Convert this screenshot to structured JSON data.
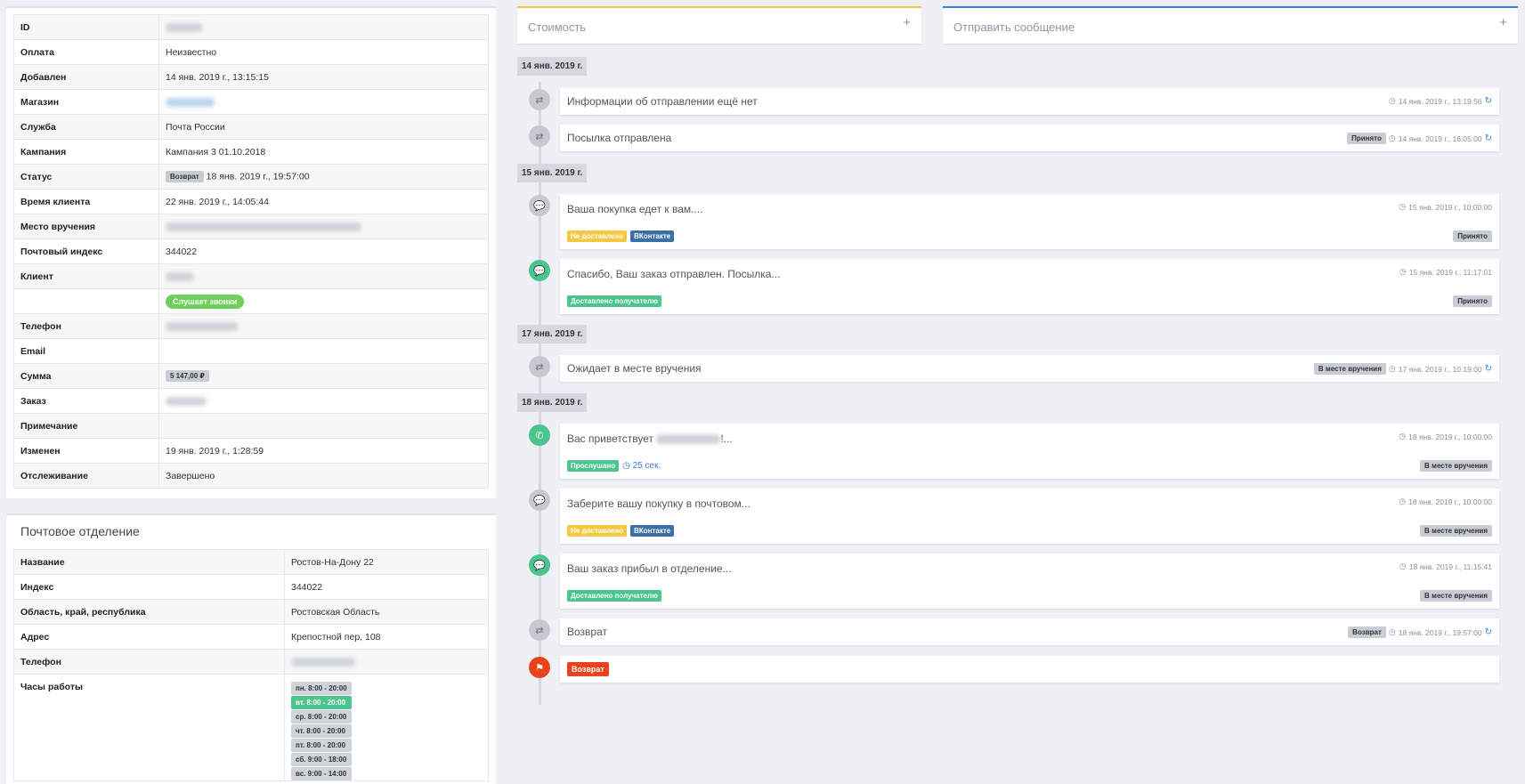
{
  "order": {
    "rows": [
      {
        "key": "ID",
        "value": ""
      },
      {
        "key": "Оплата",
        "value": "Неизвестно"
      },
      {
        "key": "Добавлен",
        "value": "14 янв. 2019 г., 13:15:15"
      },
      {
        "key": "Магазин",
        "value": ""
      },
      {
        "key": "Служба",
        "value": "Почта России"
      },
      {
        "key": "Кампания",
        "value": "Кампания 3 01.10.2018"
      },
      {
        "key": "Статус",
        "badge": "Возврат",
        "value": "18 янв. 2019 г., 19:57:00"
      },
      {
        "key": "Время клиента",
        "value": "22 янв. 2019 г., 14:05:44"
      },
      {
        "key": "Место вручения",
        "value": ""
      },
      {
        "key": "Почтовый индекс",
        "value": "344022"
      },
      {
        "key": "Клиент",
        "value": ""
      },
      {
        "key": "",
        "pill": "Слушает звонки"
      },
      {
        "key": "Телефон",
        "value": ""
      },
      {
        "key": "Email",
        "value": ""
      },
      {
        "key": "Сумма",
        "badge": "5 147,00 ₽"
      },
      {
        "key": "Заказ",
        "value": ""
      },
      {
        "key": "Примечание",
        "value": ""
      },
      {
        "key": "Изменен",
        "value": "19 янв. 2019 г., 1:28:59"
      },
      {
        "key": "Отслеживание",
        "value": "Завершено"
      }
    ]
  },
  "office": {
    "title": "Почтовое отделение",
    "rows": [
      {
        "key": "Название",
        "value": "Ростов-На-Дону 22"
      },
      {
        "key": "Индекс",
        "value": "344022"
      },
      {
        "key": "Область, край, республика",
        "value": "Ростовская Область"
      },
      {
        "key": "Адрес",
        "value": "Крепостной пер, 108"
      },
      {
        "key": "Телефон",
        "value": ""
      }
    ],
    "hours_label": "Часы работы",
    "hours": [
      "пн. 8:00 - 20:00",
      "вт. 8:00 - 20:00",
      "ср. 8:00 - 20:00",
      "чт. 8:00 - 20:00",
      "пт. 8:00 - 20:00",
      "сб. 9:00 - 18:00",
      "вс. 9:00 - 14:00"
    ],
    "hours_active_index": 1
  },
  "panels": {
    "cost": "Стоимость",
    "message": "Отправить сообщение",
    "plus": "+"
  },
  "timeline": {
    "dates": [
      "14 янв. 2019 г.",
      "15 янв. 2019 г.",
      "17 янв. 2019 г.",
      "18 янв. 2019 г."
    ],
    "events": [
      {
        "title": "Информации об отправлении ещё нет",
        "time": "14 янв. 2019 г., 13:19:56",
        "icon": "transfer-icon"
      },
      {
        "title": "Посылка отправлена",
        "badge": "Принято",
        "time": "14 янв. 2019 г., 16:05:00",
        "icon": "transfer-icon"
      },
      {
        "title": "Ваша покупка едет к вам....",
        "time": "15 янв. 2019 г., 10:00:00",
        "tags": [
          "Не доставлено",
          "ВКонтакте"
        ],
        "status": "Принято",
        "icon": "chat-icon"
      },
      {
        "title": "Спасибо, Ваш заказ отправлен. Посылка...",
        "time": "15 янв. 2019 г., 11:17:01",
        "tags": [
          "Доставлено получателю"
        ],
        "status": "Принято",
        "icon": "chat-icon"
      },
      {
        "title": "Ожидает в месте вручения",
        "badge": "В месте вручения",
        "time": "17 янв. 2019 г., 10:19:00",
        "icon": "transfer-icon"
      },
      {
        "title_prefix": "Вас приветствует",
        "title_suffix": "!...",
        "time": "18 янв. 2019 г., 10:00:00",
        "tags": [
          "Прослушано"
        ],
        "duration": "25 сек.",
        "status": "В месте вручения",
        "icon": "phone-icon"
      },
      {
        "title": "Заберите вашу покупку в почтовом...",
        "time": "18 янв. 2019 г., 10:00:00",
        "tags": [
          "Не доставлено",
          "ВКонтакте"
        ],
        "status": "В месте вручения",
        "icon": "chat-icon"
      },
      {
        "title": "Ваш заказ прибыл в отделение...",
        "time": "18 янв. 2019 г., 11:15:41",
        "tags": [
          "Доставлено получателю"
        ],
        "status": "В месте вручения",
        "icon": "chat-icon"
      },
      {
        "title": "Возврат",
        "badge": "Возврат",
        "time": "18 янв. 2019 г., 19:57:00",
        "icon": "transfer-icon"
      },
      {
        "final_tag": "Возврат",
        "icon": "flag-icon"
      }
    ]
  },
  "colors": {
    "accent_blue": "#3b7dd8",
    "cost_bar": "#f5c842",
    "green": "#4bc48e",
    "red": "#e8431c"
  }
}
